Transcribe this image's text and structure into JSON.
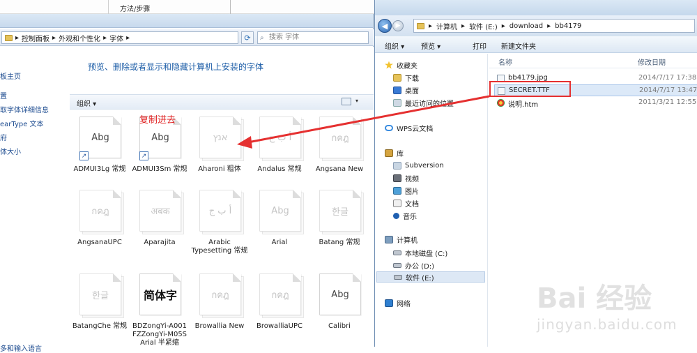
{
  "background_page": {
    "method_label": "方法/步骤"
  },
  "fonts_window": {
    "breadcrumb": [
      "控制面板",
      "外观和个性化",
      "字体"
    ],
    "search_placeholder": "搜索 字体",
    "nav_links": [
      "板主页",
      "置",
      "取字体详细信息",
      "earType 文本",
      "府",
      "体大小"
    ],
    "nav_bottom_link": "多和输入语言",
    "heading": "预览、删除或者显示和隐藏计算机上安装的字体",
    "toolbar_organize": "组织 ▾",
    "fonts": [
      {
        "preview": "Abg",
        "name": "ADMUI3Lg 常规",
        "style": "normal",
        "shortcut": true
      },
      {
        "preview": "Abg",
        "name": "ADMUI3Sm 常规",
        "style": "normal",
        "shortcut": true
      },
      {
        "preview": "אנץ",
        "name": "Aharoni 粗体",
        "style": "ghost",
        "shortcut": false
      },
      {
        "preview": "أ ب ج",
        "name": "Andalus 常规",
        "style": "ghost",
        "shortcut": false
      },
      {
        "preview": "กคฎ",
        "name": "Angsana New",
        "style": "ghost",
        "shortcut": false
      },
      {
        "preview": "กคฎ",
        "name": "AngsanaUPC",
        "style": "ghost",
        "shortcut": false
      },
      {
        "preview": "अबक",
        "name": "Aparajita",
        "style": "ghost",
        "shortcut": false
      },
      {
        "preview": "أ ب ج",
        "name": "Arabic Typesetting 常规",
        "style": "ghost",
        "shortcut": false
      },
      {
        "preview": "Abg",
        "name": "Arial",
        "style": "ghost",
        "shortcut": false
      },
      {
        "preview": "한글",
        "name": "Batang 常规",
        "style": "ghost",
        "shortcut": false
      },
      {
        "preview": "한글",
        "name": "BatangChe 常规",
        "style": "ghost",
        "shortcut": false
      },
      {
        "preview": "简体字",
        "name": "BDZongYi-A001 FZZongYi-M05S Arial 半紧缩",
        "style": "dark",
        "shortcut": false
      },
      {
        "preview": "กคฎ",
        "name": "Browallia New",
        "style": "ghost",
        "shortcut": false
      },
      {
        "preview": "กคฎ",
        "name": "BrowalliaUPC",
        "style": "ghost",
        "shortcut": false
      },
      {
        "preview": "Abg",
        "name": "Calibri",
        "style": "normal",
        "shortcut": false
      }
    ],
    "annotation": "复制进去"
  },
  "explorer_window": {
    "breadcrumb": [
      "计算机",
      "软件 (E:)",
      "download",
      "bb4179"
    ],
    "toolbar": [
      "组织 ▾",
      "预览 ▾",
      "打印",
      "新建文件夹"
    ],
    "nav": {
      "favorites_header": "收藏夹",
      "favorites": [
        "下载",
        "桌面",
        "最近访问的位置"
      ],
      "wps": "WPS云文档",
      "library_header": "库",
      "library": [
        "Subversion",
        "视频",
        "图片",
        "文档",
        "音乐"
      ],
      "computer_header": "计算机",
      "drives": [
        "本地磁盘 (C:)",
        "办公 (D:)",
        "软件 (E:)"
      ],
      "network": "网络"
    },
    "columns": {
      "name": "名称",
      "modified": "修改日期"
    },
    "files": [
      {
        "name": "bb4179.jpg",
        "date": "2014/7/17 17:38",
        "type": "image"
      },
      {
        "name": "SECRET.TTF",
        "date": "2014/7/17 13:47",
        "type": "font",
        "selected": true
      },
      {
        "name": "说明.htm",
        "date": "2011/3/21 12:55",
        "type": "html"
      }
    ]
  },
  "watermark": {
    "brand": "Bai 经验",
    "url": "jingyan.baidu.com"
  },
  "colors": {
    "accent_blue": "#1f5fa8",
    "annotation_red": "#e02020"
  }
}
